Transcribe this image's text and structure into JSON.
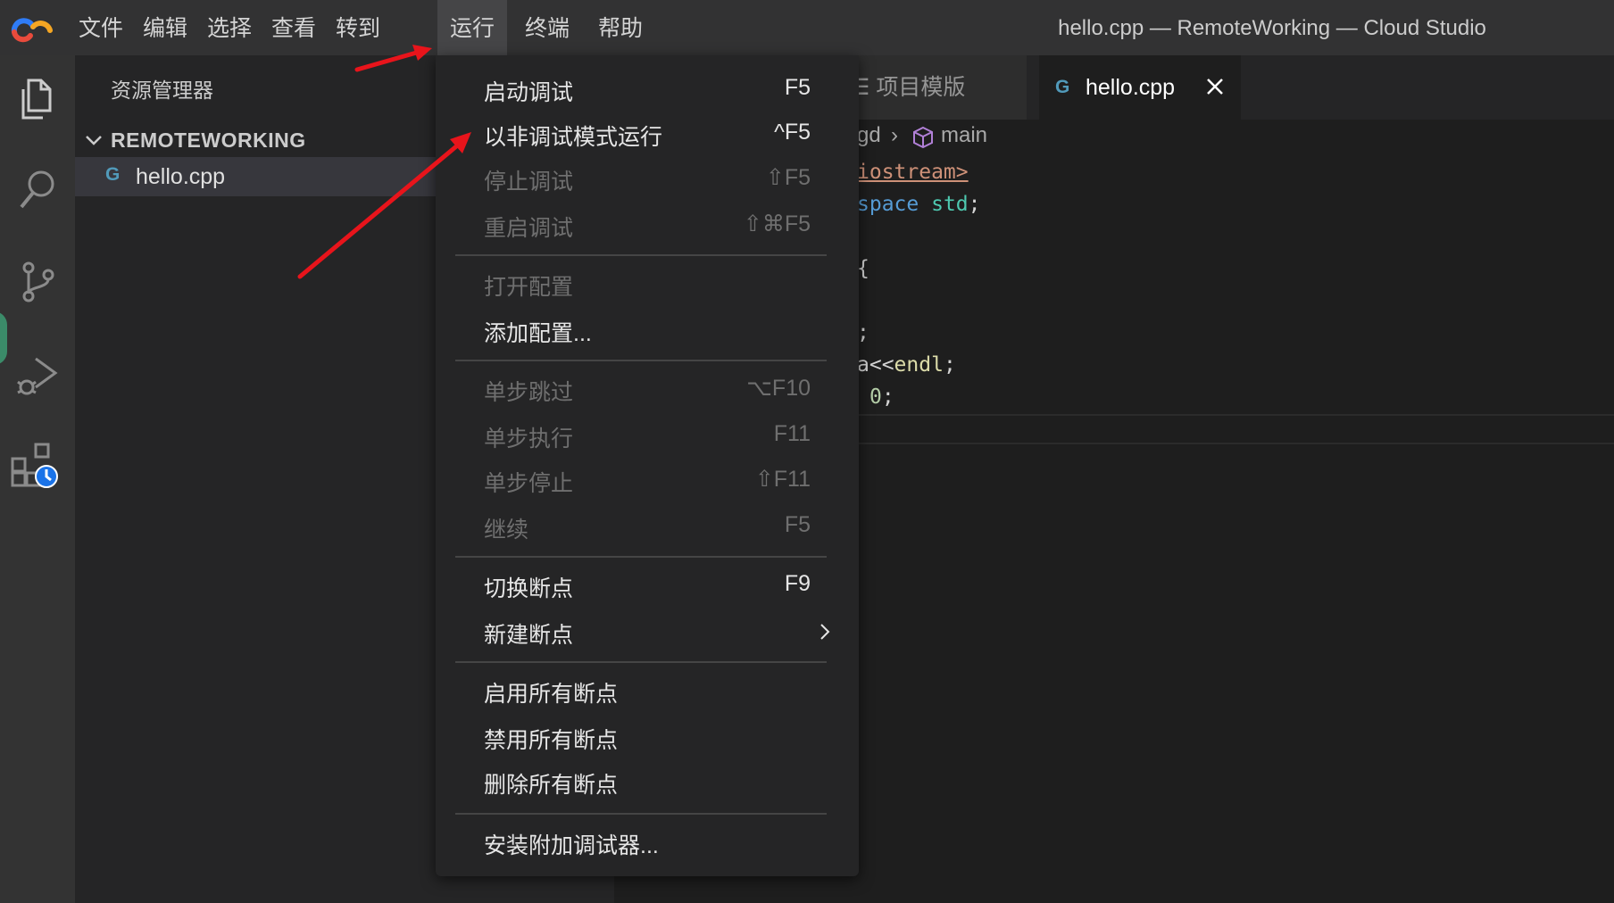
{
  "menubar": {
    "items": [
      "文件",
      "编辑",
      "选择",
      "查看",
      "转到",
      "运行",
      "终端",
      "帮助"
    ],
    "active_index": 5,
    "window_title": "hello.cpp — RemoteWorking — Cloud Studio"
  },
  "activitybar": {
    "icons": [
      "explorer-icon",
      "search-icon",
      "source-control-icon",
      "run-debug-icon",
      "extensions-icon"
    ]
  },
  "sidebar": {
    "title": "资源管理器",
    "folder": "REMOTEWORKING",
    "file_icon": "G",
    "file": "hello.cpp"
  },
  "tabs": {
    "template_icon": "☰",
    "template": "项目模版",
    "active_icon": "G",
    "active": "hello.cpp"
  },
  "breadcrumb": {
    "folder_fragment": "gd",
    "separator": "›",
    "symbol": "main"
  },
  "code": {
    "line1_str": "iostream>",
    "line2_kw": "space",
    "line2_ty": "std",
    "line2_end": ";",
    "line3": "{",
    "line4": ";",
    "line5_a": "a<<",
    "line5_fn": "endl",
    "line5_end": ";",
    "line6_num": "0",
    "line6_end": ";"
  },
  "run_menu": {
    "start_debugging": {
      "label": "启动调试",
      "key": "F5"
    },
    "run_without_debugging": {
      "label": "以非调试模式运行",
      "key": "^F5"
    },
    "stop_debugging": {
      "label": "停止调试",
      "key": "⇧F5"
    },
    "restart_debugging": {
      "label": "重启调试",
      "key": "⇧⌘F5"
    },
    "open_configurations": {
      "label": "打开配置"
    },
    "add_configuration": {
      "label": "添加配置..."
    },
    "step_over": {
      "label": "单步跳过",
      "key": "⌥F10"
    },
    "step_into": {
      "label": "单步执行",
      "key": "F11"
    },
    "step_out": {
      "label": "单步停止",
      "key": "⇧F11"
    },
    "continue": {
      "label": "继续",
      "key": "F5"
    },
    "toggle_breakpoint": {
      "label": "切换断点",
      "key": "F9"
    },
    "new_breakpoint": {
      "label": "新建断点"
    },
    "enable_all_breakpoints": {
      "label": "启用所有断点"
    },
    "disable_all_breakpoints": {
      "label": "禁用所有断点"
    },
    "remove_all_breakpoints": {
      "label": "删除所有断点"
    },
    "install_debuggers": {
      "label": "安装附加调试器..."
    }
  },
  "colors": {
    "menubar_bg": "#323233",
    "sidebar_bg": "#252526",
    "editor_bg": "#1e1e1e",
    "annotation_arrow": "#e8141b",
    "cpp_icon": "#519aba"
  }
}
